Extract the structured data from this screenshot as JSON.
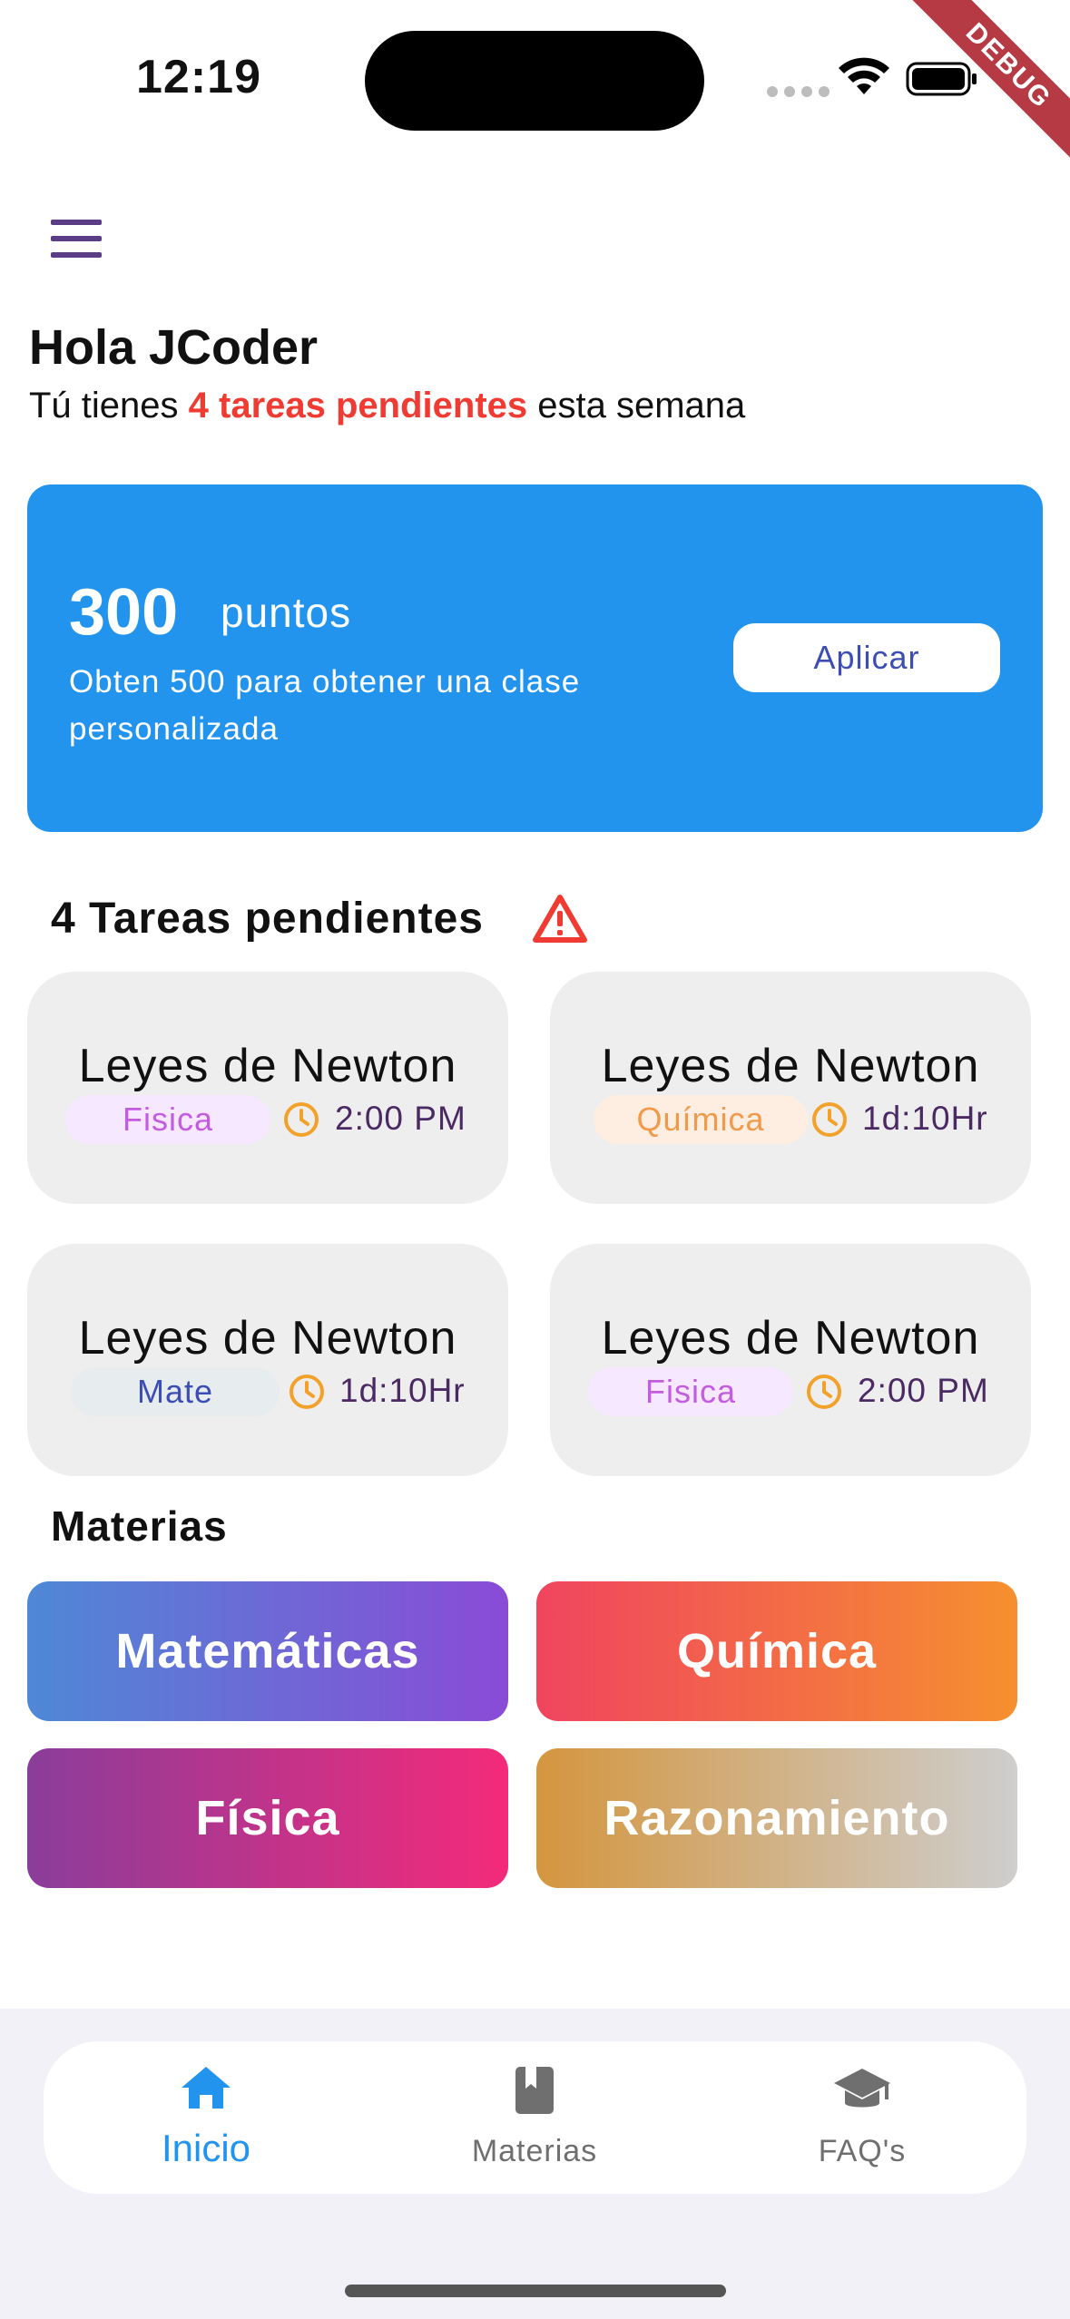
{
  "status_bar": {
    "time": "12:19",
    "debug_banner": "DEBUG"
  },
  "header": {
    "greeting": "Hola JCoder",
    "subtitle_prefix": "Tú tienes ",
    "subtitle_highlight": "4 tareas pendientes",
    "subtitle_suffix": " esta semana"
  },
  "points_card": {
    "points": "300",
    "points_label": "puntos",
    "description": "Obten 500 para obtener una clase personalizada",
    "button_label": "Aplicar"
  },
  "tasks": {
    "title": "4 Tareas pendientes",
    "items": [
      {
        "title": "Leyes de Newton",
        "tag": "Fisica",
        "due": "2:00 PM"
      },
      {
        "title": "Leyes de Newton",
        "tag": "Química",
        "due": "1d:10Hr"
      },
      {
        "title": "Leyes de Newton",
        "tag": "Mate",
        "due": "1d:10Hr"
      },
      {
        "title": "Leyes de Newton",
        "tag": "Fisica",
        "due": "2:00 PM"
      }
    ]
  },
  "materias": {
    "title": "Materias",
    "items": [
      {
        "label": "Matemáticas"
      },
      {
        "label": "Química"
      },
      {
        "label": "Física"
      },
      {
        "label": "Razonamiento"
      }
    ]
  },
  "bottom_nav": {
    "items": [
      {
        "label": "Inicio",
        "icon": "home-icon",
        "active": true
      },
      {
        "label": "Materias",
        "icon": "book-icon",
        "active": false
      },
      {
        "label": "FAQ's",
        "icon": "graduation-cap-icon",
        "active": false
      }
    ]
  },
  "colors": {
    "accent_blue": "#2394ee",
    "highlight_red": "#ef3b32",
    "nav_active": "#2394ee",
    "nav_inactive": "#6f6f6f"
  }
}
